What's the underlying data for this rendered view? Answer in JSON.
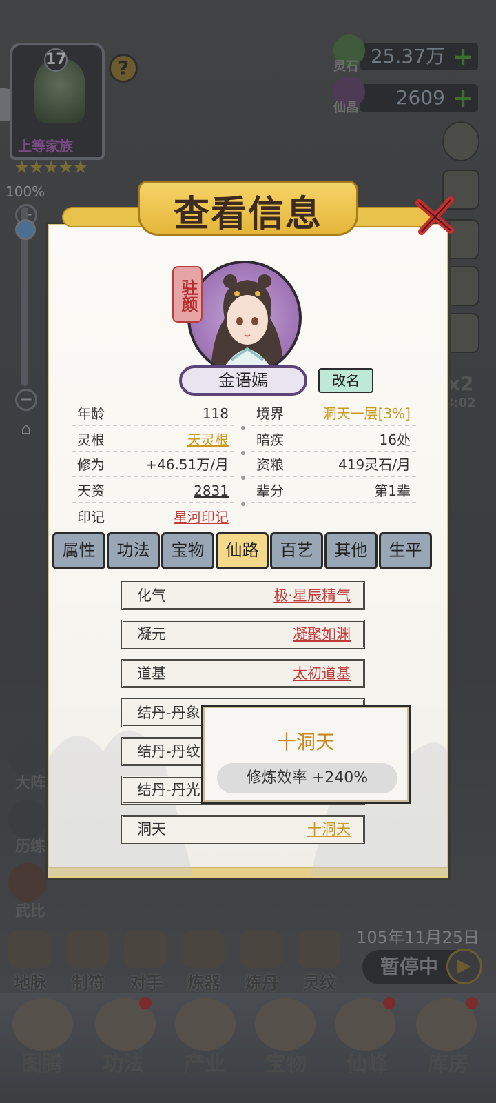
{
  "clan": {
    "level": "17",
    "rank": "上等家族",
    "stars": "★★★★★",
    "help": "?"
  },
  "zoom": {
    "percent": "100%",
    "plus": "+",
    "minus": "−",
    "level_fraction": 1.0
  },
  "resources": [
    {
      "label": "灵石",
      "value": "25.37万",
      "plus": "+"
    },
    {
      "label": "仙晶",
      "value": "2609",
      "plus": "+"
    }
  ],
  "left_side": [
    "大阵",
    "历练",
    "武比"
  ],
  "speed_badge": {
    "mult": "x2",
    "time": "3:02"
  },
  "bottom_row": [
    "地脉",
    "制符",
    "对手",
    "炼器",
    "炼丹",
    "灵纹"
  ],
  "date": "105年11月25日",
  "pause": {
    "label": "暂停中",
    "play": "▶"
  },
  "nav": [
    "图腾",
    "功法",
    "产业",
    "宝物",
    "仙峰",
    "库房"
  ],
  "dialog": {
    "title": "查看信息",
    "seal": "驻颜",
    "name": "金语嫣",
    "rename": "改名",
    "info_left": [
      {
        "k": "年龄",
        "v": "118"
      },
      {
        "k": "灵根",
        "v": "天灵根"
      },
      {
        "k": "修为",
        "v": "+46.51万/月"
      },
      {
        "k": "天资",
        "v": "2831"
      },
      {
        "k": "印记",
        "v": "星河印记"
      }
    ],
    "info_right": [
      {
        "k": "境界",
        "v": "洞天一层[3%]"
      },
      {
        "k": "暗疾",
        "v": "16处"
      },
      {
        "k": "资粮",
        "v": "419灵石/月"
      },
      {
        "k": "辈分",
        "v": "第1辈"
      }
    ],
    "tabs": [
      "属性",
      "功法",
      "宝物",
      "仙路",
      "百艺",
      "其他",
      "生平"
    ],
    "active_tab": "仙路",
    "path": [
      {
        "k": "化气",
        "v": "极·星辰精气"
      },
      {
        "k": "凝元",
        "v": "凝聚如渊"
      },
      {
        "k": "道基",
        "v": "太初道基"
      },
      {
        "k": "结丹-丹象",
        "v": ""
      },
      {
        "k": "结丹-丹纹",
        "v": ""
      },
      {
        "k": "结丹-丹光",
        "v": ""
      },
      {
        "k": "洞天",
        "v": "十洞天"
      }
    ]
  },
  "tooltip": {
    "title": "十洞天",
    "stat": "修炼效率  +240%"
  },
  "colors": {
    "gold": "#c99a1c",
    "red": "#c43a3a",
    "tab": "#98a6b6",
    "tab_active": "#f4d98a"
  }
}
